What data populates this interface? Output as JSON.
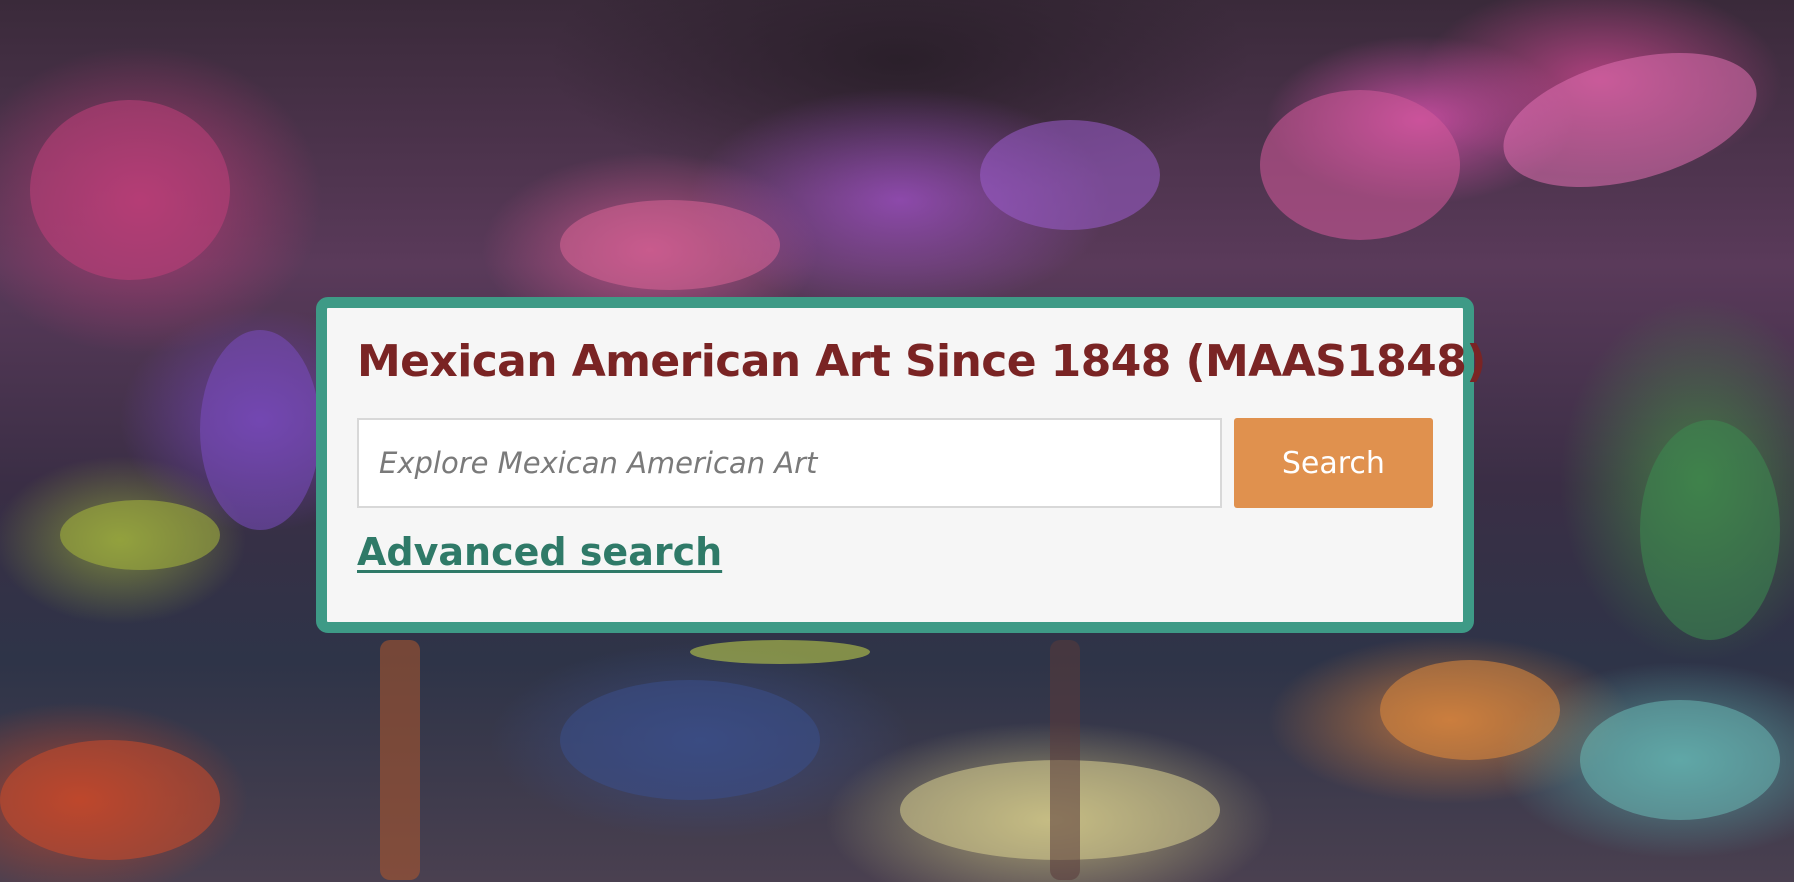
{
  "hero": {
    "background_image": "colorful impressionist painting of flowering trees (pink and purple blossoms) over a river",
    "accent_colors": {
      "panel_border": "#3e9a86",
      "title": "#7a2424",
      "search_button": "#e0914e",
      "advanced_link": "#2f7a68"
    }
  },
  "search_panel": {
    "title": "Mexican American Art Since 1848 (MAAS1848)",
    "search_input": {
      "placeholder": "Explore Mexican American Art",
      "value": ""
    },
    "search_button_label": "Search",
    "advanced_search_label": "Advanced search"
  }
}
